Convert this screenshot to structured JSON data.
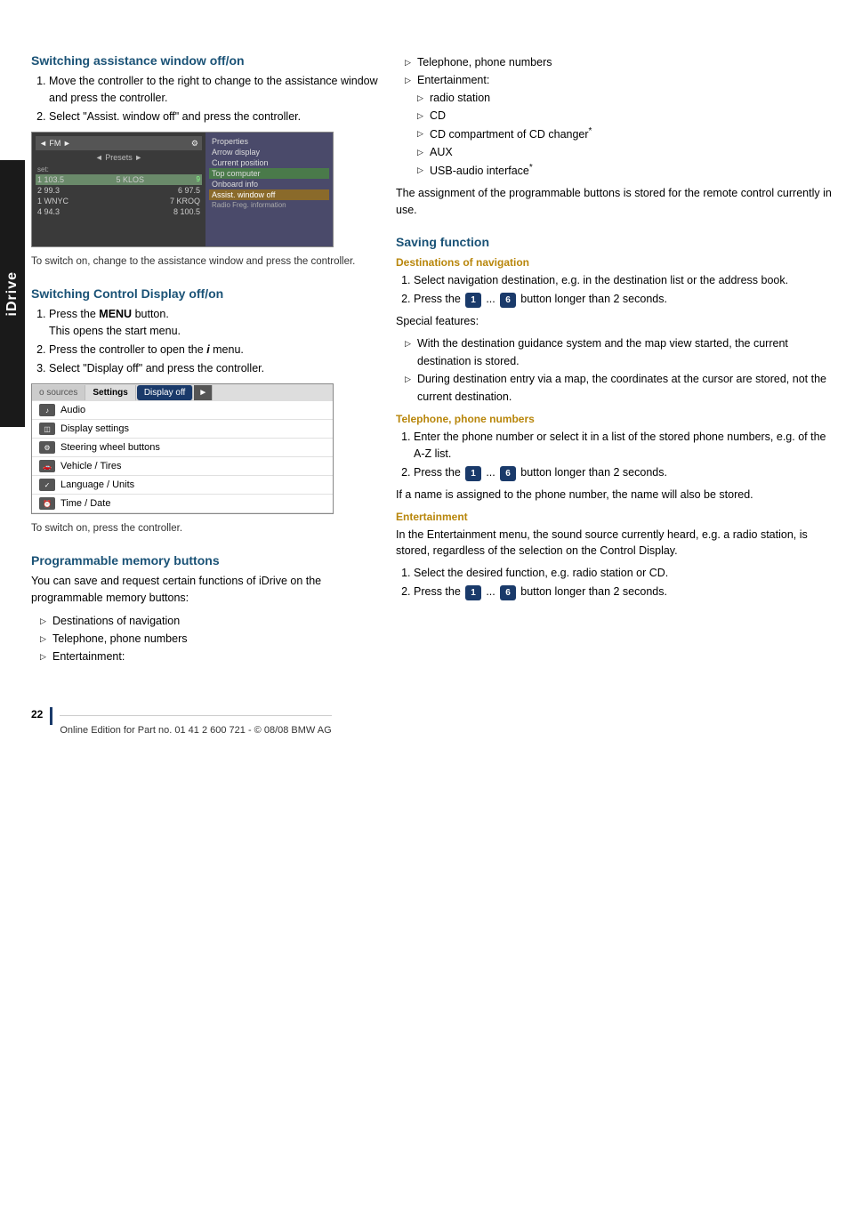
{
  "page": {
    "side_tab": "iDrive",
    "page_number": "22",
    "footer": "Online Edition for Part no. 01 41 2 600 721 - © 08/08 BMW AG"
  },
  "section1": {
    "title": "Switching assistance window off/on",
    "steps": [
      "Move the controller to the right to change to the assistance window and press the controller.",
      "Select \"Assist. window off\" and press the controller."
    ],
    "caption": "To switch on, change to the assistance window and press the controller."
  },
  "section2": {
    "title": "Switching Control Display off/on",
    "steps": [
      {
        "text": "Press the ",
        "bold": "MENU",
        "text2": " button.\nThis opens the start menu."
      },
      "Press the controller to open the i menu.",
      "Select \"Display off\" and press the controller."
    ],
    "caption": "To switch on, press the controller."
  },
  "section3": {
    "title": "Programmable memory buttons",
    "intro": "You can save and request certain functions of iDrive on the programmable memory buttons:",
    "bullet_items": [
      "Destinations of navigation",
      "Telephone, phone numbers",
      "Entertainment:",
      "radio station",
      "CD",
      "CD compartment of CD changer*",
      "AUX",
      "USB-audio interface*"
    ],
    "note": "The assignment of the programmable buttons is stored for the remote control currently in use."
  },
  "section4": {
    "title": "Saving function",
    "sub_title1": "Destinations of navigation",
    "nav_steps": [
      "Select navigation destination, e.g. in the destination list or the address book.",
      "Press the  1  ...  6  button longer than 2 seconds."
    ],
    "special_features_label": "Special features:",
    "special_bullets": [
      "With the destination guidance system and the map view started, the current destination is stored.",
      "During destination entry via a map, the coordinates at the cursor are stored, not the current destination."
    ],
    "sub_title2": "Telephone, phone numbers",
    "phone_steps": [
      "Enter the phone number or select it in a list of the stored phone numbers, e.g. of the A-Z list.",
      "Press the  1  ...  6  button longer than 2 seconds."
    ],
    "phone_note": "If a name is assigned to the phone number, the name will also be stored.",
    "sub_title3": "Entertainment",
    "entertainment_text": "In the Entertainment menu, the sound source currently heard, e.g. a radio station, is stored, regardless of the selection on the Control Display.",
    "entertainment_steps": [
      "Select the desired function, e.g. radio station or CD.",
      "Press the  1  ...  6  button longer than 2 seconds."
    ]
  },
  "radio_screen": {
    "top_bar": "◄  FM ►",
    "presets": "◄ Presets ►",
    "stations": [
      {
        "freq": "1 103.5",
        "name": "5 KLOS"
      },
      {
        "freq": "2 99.3",
        "name": "6 97.5"
      },
      {
        "freq": "1 WNYC",
        "name": "7 KROQ"
      },
      {
        "freq": "4 94.3",
        "name": "8 100.5"
      }
    ],
    "menu_items": [
      "Properties",
      "Arrow display",
      "Current position",
      "Top computer",
      "Onboard info",
      "Assist. window off"
    ]
  },
  "settings_screen": {
    "tabs": [
      "o sources",
      "Settings",
      "Display off",
      "►"
    ],
    "menu_items": [
      {
        "icon": "♪",
        "label": "Audio"
      },
      {
        "icon": "◫",
        "label": "Display settings"
      },
      {
        "icon": "⚙",
        "label": "Steering wheel buttons"
      },
      {
        "icon": "🚗",
        "label": "Vehicle / Tires"
      },
      {
        "icon": "✓",
        "label": "Language / Units"
      },
      {
        "icon": "⏰",
        "label": "Time / Date"
      }
    ]
  }
}
